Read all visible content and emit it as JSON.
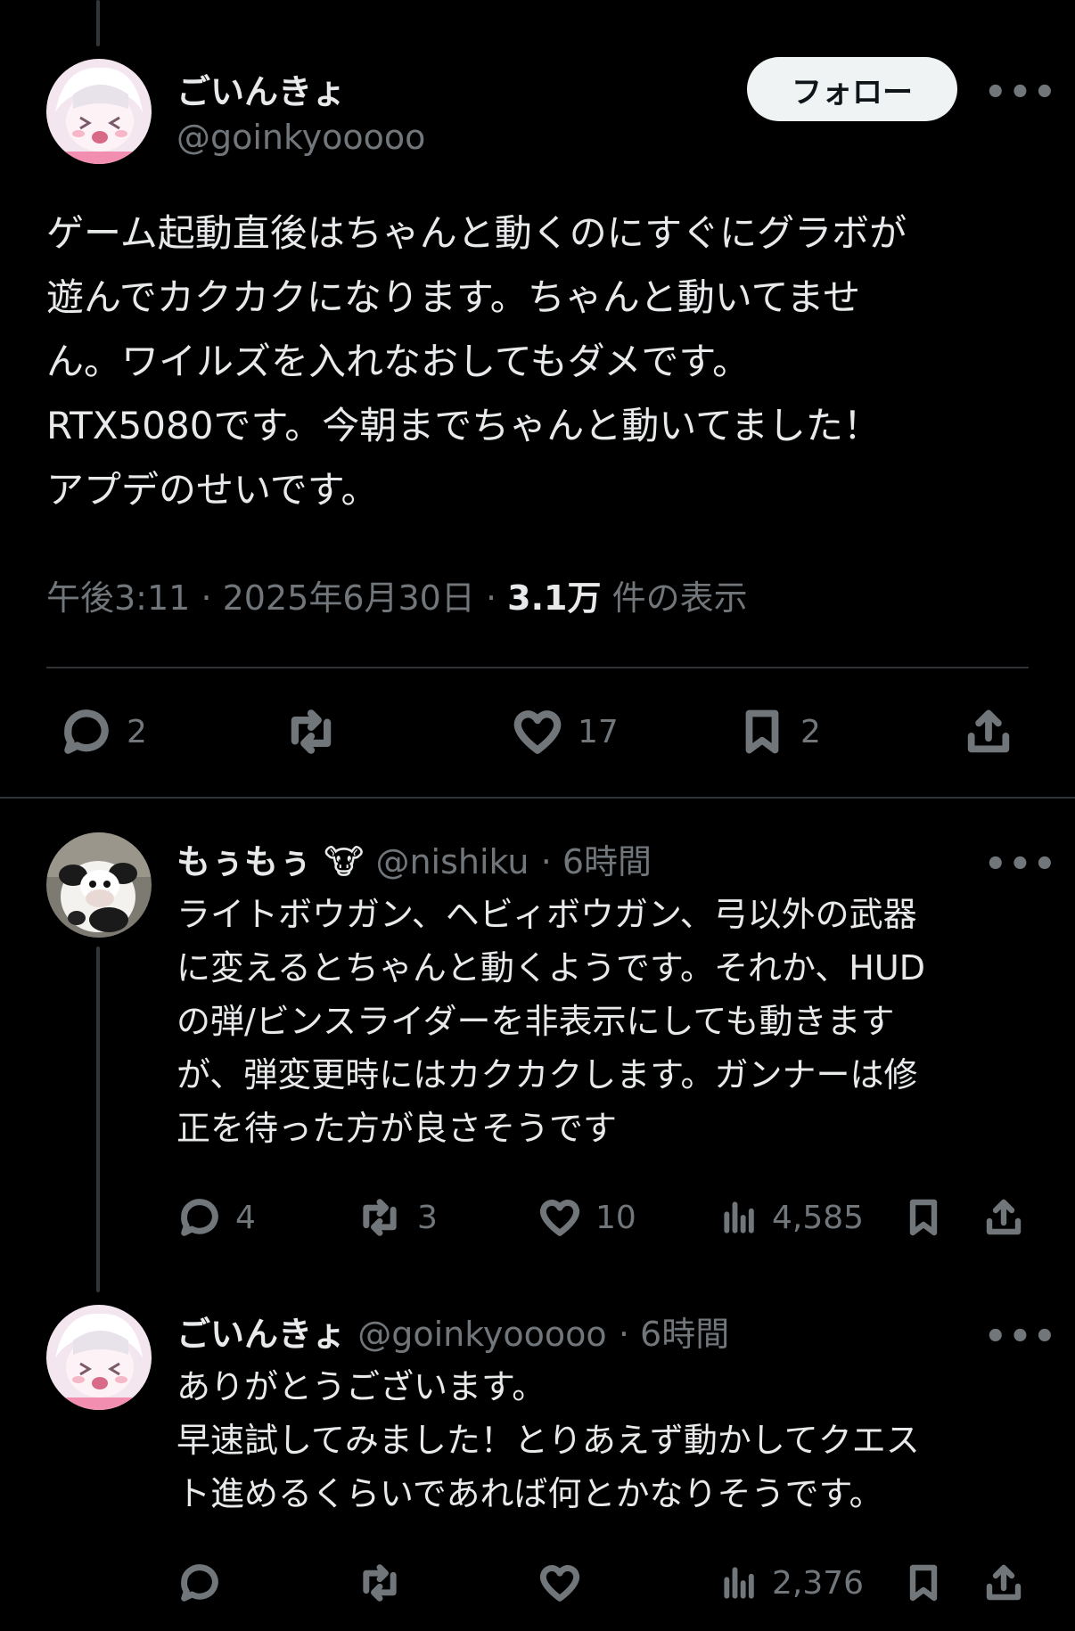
{
  "main_tweet": {
    "author_name": "ごいんきょ",
    "handle": "@goinkyooooo",
    "follow_label": "フォロー",
    "more_label": "•••",
    "text": "ゲーム起動直後はちゃんと動くのにすぐにグラボが\n遊んでカクカクになります。ちゃんと動いてませ\nん。ワイルズを入れなおしてもダメです。\nRTX5080です。今朝までちゃんと動いてました！\nアプデのせいです。",
    "time": "午後3:11",
    "date": "2025年6月30日",
    "sep": "·",
    "views_count": "3.1万",
    "views_label": "件の表示",
    "replies": "2",
    "likes": "17",
    "bookmarks": "2"
  },
  "reply1": {
    "author_name": "もぅもぅ",
    "emoji": "🐮",
    "handle": "@nishiku",
    "time": "· 6時間",
    "more_label": "•••",
    "text": "ライトボウガン、ヘビィボウガン、弓以外の武器\nに変えるとちゃんと動くようです。それか、HUD\nの弾/ビンスライダーを非表示にしても動きます\nが、弾変更時にはカクカクします。ガンナーは修\n正を待った方が良さそうです",
    "replies": "4",
    "reposts": "3",
    "likes": "10",
    "views": "4,585"
  },
  "reply2": {
    "author_name": "ごいんきょ",
    "handle": "@goinkyooooo",
    "time": "· 6時間",
    "more_label": "•••",
    "text": "ありがとうございます。\n早速試してみました！とりあえず動かしてクエス\nト進めるくらいであれば何とかなりそうです。",
    "views": "2,376"
  },
  "colors": {
    "background": "#000000",
    "text": "#e7e9ea",
    "muted": "#71767b",
    "divider": "#2f3336",
    "follow_bg": "#eff3f4"
  }
}
